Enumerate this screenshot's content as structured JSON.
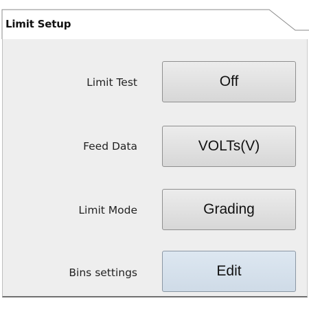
{
  "panel": {
    "title": "Limit Setup"
  },
  "settings": [
    {
      "label": "Limit Test",
      "value": "Off"
    },
    {
      "label": "Feed Data",
      "value": "VOLTs(V)"
    },
    {
      "label": "Limit Mode",
      "value": "Grading"
    },
    {
      "label": "Bins settings",
      "value": "Edit"
    }
  ],
  "colors": {
    "panel_bg": "#eeeeee",
    "button_bg": "#e2e2e2",
    "edit_button_bg": "#d6e1ec"
  }
}
